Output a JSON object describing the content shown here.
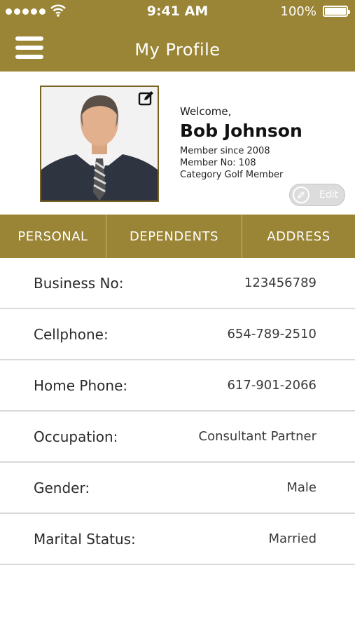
{
  "status_bar": {
    "time": "9:41 AM",
    "battery": "100%"
  },
  "header": {
    "title": "My Profile",
    "menu_icon": "hamburger-menu-icon"
  },
  "profile": {
    "welcome": "Welcome,",
    "name": "Bob Johnson",
    "member_since": "Member since 2008",
    "member_no": "Member No: 108",
    "category": "Category Golf Member",
    "edit_label": "Edit"
  },
  "tabs": [
    {
      "label": "PERSONAL"
    },
    {
      "label": "DEPENDENTS"
    },
    {
      "label": "ADDRESS"
    }
  ],
  "details": [
    {
      "label": "Business No:",
      "value": "123456789"
    },
    {
      "label": "Cellphone:",
      "value": "654-789-2510"
    },
    {
      "label": "Home Phone:",
      "value": "617-901-2066"
    },
    {
      "label": "Occupation:",
      "value": "Consultant Partner"
    },
    {
      "label": "Gender:",
      "value": "Male"
    },
    {
      "label": "Marital Status:",
      "value": "Married"
    }
  ],
  "colors": {
    "accent": "#9a8435",
    "divider": "#d9d9d9"
  }
}
